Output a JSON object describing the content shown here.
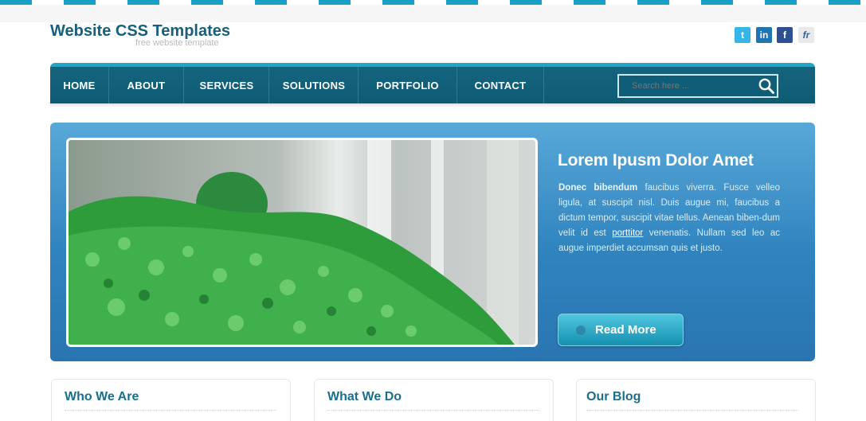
{
  "header": {
    "title": "Website CSS Templates",
    "subtitle": "free website template",
    "social": [
      {
        "icon": "twitter-icon",
        "glyph": "t"
      },
      {
        "icon": "linkedin-icon",
        "glyph": "in"
      },
      {
        "icon": "facebook-icon",
        "glyph": "f"
      },
      {
        "icon": "friendfeed-icon",
        "glyph": "fr"
      }
    ]
  },
  "nav": {
    "items": [
      {
        "label": "HOME"
      },
      {
        "label": "ABOUT"
      },
      {
        "label": "SERVICES"
      },
      {
        "label": "SOLUTIONS"
      },
      {
        "label": "PORTFOLIO"
      },
      {
        "label": "CONTACT"
      }
    ],
    "search_placeholder": "Search here ..."
  },
  "hero": {
    "title": "Lorem Ipusm Dolor Amet",
    "bold_lead": "Donec bibendum",
    "text_1": " faucibus viverra. Fusce velleo ligula, at suscipit nisl. Duis augue mi, faucibus a dictum tempor, suscipit vitae tellus. Aenean biben-dum velit id est ",
    "link": "porttitor",
    "text_2": " venenatis. Nullam sed leo ac augue imperdiet accumsan quis et justo.",
    "button": "Read More"
  },
  "boxes": [
    {
      "title": "Who We Are"
    },
    {
      "title": "What We Do"
    },
    {
      "title": "Our Blog"
    }
  ],
  "colors": {
    "brand": "#16607a",
    "accent": "#1aa0c4",
    "nav": "#0e5b74"
  }
}
